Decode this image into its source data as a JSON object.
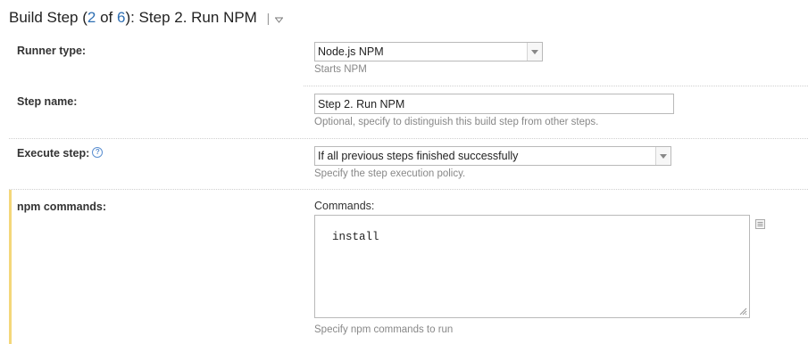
{
  "header": {
    "prefix": "Build Step (",
    "step_current": "2",
    "of": " of ",
    "step_total": "6",
    "suffix": "): Step 2. Run NPM",
    "separator": "|",
    "dropdown_icon": "triangle-down-icon"
  },
  "runner_type": {
    "label": "Runner type:",
    "value": "Node.js NPM",
    "note": "Starts NPM"
  },
  "step_name": {
    "label": "Step name:",
    "value": "Step 2. Run NPM",
    "note": "Optional, specify to distinguish this build step from other steps."
  },
  "execute_step": {
    "label": "Execute step:",
    "help_icon": "question-circle-icon",
    "value": "If all previous steps finished successfully",
    "note": "Specify the step execution policy."
  },
  "npm_commands": {
    "label": "npm commands:",
    "commands_label": "Commands:",
    "commands_value": "install",
    "note": "Specify npm commands to run",
    "editor_icon": "expand-editor-icon"
  },
  "colors": {
    "link": "#2f6fb3",
    "highlight_bar": "#f4d77a",
    "note_text": "#888888"
  }
}
